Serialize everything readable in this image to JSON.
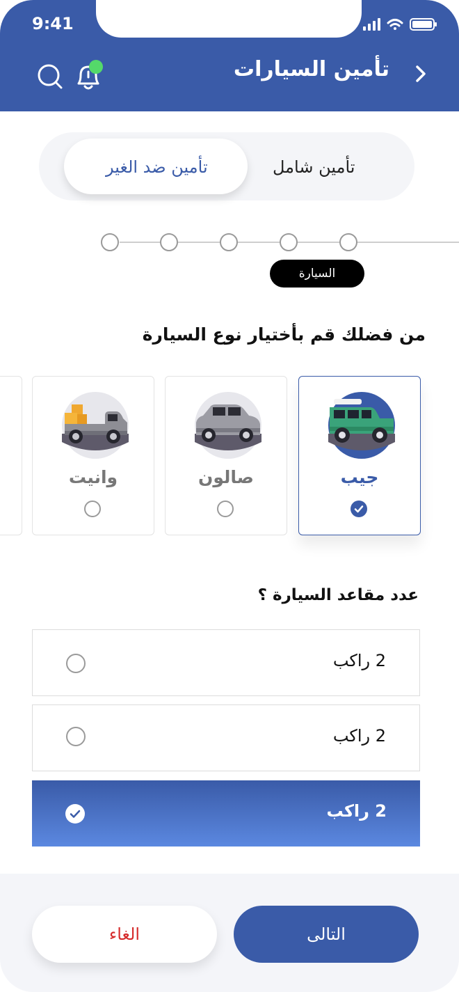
{
  "status_bar": {
    "time": "9:41"
  },
  "header": {
    "title": "تأمين السيارات",
    "bg_color": "#3a5ba8",
    "icons": [
      "chevron-right-icon",
      "bell-icon",
      "search-icon"
    ],
    "notification_dot_color": "#54d96a"
  },
  "segment": {
    "tabs": [
      {
        "label": "تأمين شامل",
        "active": false
      },
      {
        "label": "تأمين ضد الغير",
        "active": true
      }
    ]
  },
  "steps": {
    "current_label": "السيارة"
  },
  "car_type": {
    "question": "من فضلك قم بأختيار نوع السيارة",
    "options": [
      {
        "label": "جيب",
        "selected": true,
        "icon": "jeep-icon"
      },
      {
        "label": "صالون",
        "selected": false,
        "icon": "sedan-icon"
      },
      {
        "label": "وانيت",
        "selected": false,
        "icon": "pickup-truck-icon"
      }
    ]
  },
  "seats": {
    "question": "عدد مقاعد السيارة ؟",
    "options": [
      {
        "label": "2 راكب",
        "selected": false
      },
      {
        "label": "2 راكب",
        "selected": false
      },
      {
        "label": "2 راكب",
        "selected": true
      }
    ]
  },
  "footer": {
    "next_label": "التالى",
    "cancel_label": "الغاء"
  },
  "colors": {
    "primary": "#3a5ba8",
    "cancel_text": "#d62b2b"
  }
}
